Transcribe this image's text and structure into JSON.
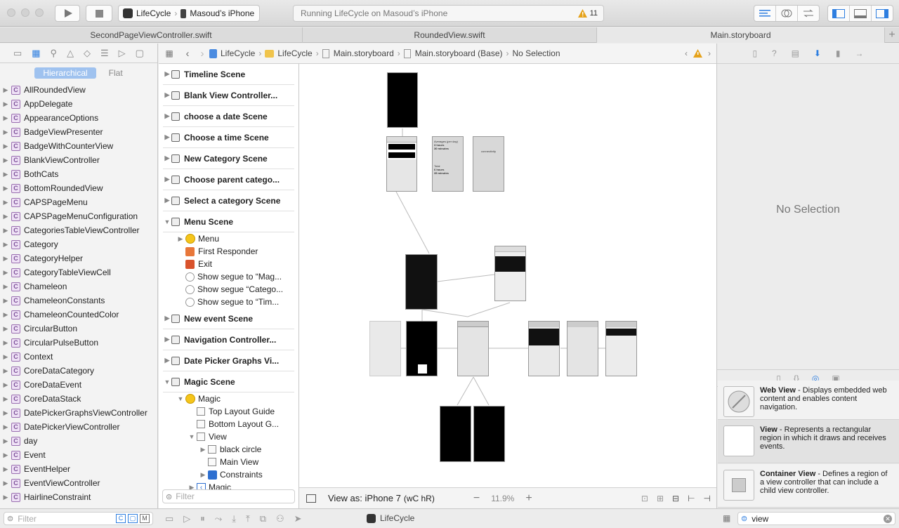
{
  "toolbar": {
    "scheme_app": "LifeCycle",
    "scheme_device": "Masoud’s iPhone",
    "status_text": "Running LifeCycle on Masoud’s iPhone",
    "warning_count": "11"
  },
  "tabs": [
    "SecondPageViewController.swift",
    "RoundedView.swift",
    "Main.storyboard"
  ],
  "navigator": {
    "mode_hierarchical": "Hierarchical",
    "mode_flat": "Flat",
    "items": [
      "AllRoundedView",
      "AppDelegate",
      "AppearanceOptions",
      "BadgeViewPresenter",
      "BadgeWithCounterView",
      "BlankViewController",
      "BothCats",
      "BottomRoundedView",
      "CAPSPageMenu",
      "CAPSPageMenuConfiguration",
      "CategoriesTableViewController",
      "Category",
      "CategoryHelper",
      "CategoryTableViewCell",
      "Chameleon",
      "ChameleonConstants",
      "ChameleonCountedColor",
      "CircularButton",
      "CircularPulseButton",
      "Context",
      "CoreDataCategory",
      "CoreDataEvent",
      "CoreDataStack",
      "DatePickerGraphsViewController",
      "DatePickerViewController",
      "day",
      "Event",
      "EventHelper",
      "EventViewController",
      "HairlineConstraint"
    ],
    "filter_placeholder": "Filter"
  },
  "jumpbar": {
    "crumbs": [
      "LifeCycle",
      "LifeCycle",
      "Main.storyboard",
      "Main.storyboard (Base)",
      "No Selection"
    ]
  },
  "outline": {
    "rows": [
      {
        "t": "scene",
        "label": "Timeline Scene",
        "open": false
      },
      {
        "t": "scene",
        "label": "Blank View Controller...",
        "open": false
      },
      {
        "t": "scene",
        "label": "choose a date Scene",
        "open": false
      },
      {
        "t": "scene",
        "label": "Choose a time Scene",
        "open": false
      },
      {
        "t": "scene",
        "label": "New Category Scene",
        "open": false
      },
      {
        "t": "scene",
        "label": "Choose parent catego...",
        "open": false
      },
      {
        "t": "scene",
        "label": "Select a category Scene",
        "open": false
      },
      {
        "t": "scene",
        "label": "Menu Scene",
        "open": true
      },
      {
        "t": "item",
        "label": "Menu",
        "indent": 1,
        "icon": "yellow"
      },
      {
        "t": "item",
        "label": "First Responder",
        "indent": 1,
        "icon": "orange"
      },
      {
        "t": "item",
        "label": "Exit",
        "indent": 1,
        "icon": "red"
      },
      {
        "t": "item",
        "label": "Show segue to “Mag...",
        "indent": 1,
        "icon": "segue"
      },
      {
        "t": "item",
        "label": "Show segue “Catego...",
        "indent": 1,
        "icon": "segue"
      },
      {
        "t": "item",
        "label": "Show segue to “Tim...",
        "indent": 1,
        "icon": "segue"
      },
      {
        "t": "scene",
        "label": "New event Scene",
        "open": false
      },
      {
        "t": "scene",
        "label": "Navigation Controller...",
        "open": false
      },
      {
        "t": "scene",
        "label": "Date Picker Graphs Vi...",
        "open": false
      },
      {
        "t": "scene",
        "label": "Magic Scene",
        "open": true
      },
      {
        "t": "item",
        "label": "Magic",
        "indent": 1,
        "icon": "yellow"
      },
      {
        "t": "item",
        "label": "Top Layout Guide",
        "indent": 2,
        "icon": "box"
      },
      {
        "t": "item",
        "label": "Bottom Layout G...",
        "indent": 2,
        "icon": "box"
      },
      {
        "t": "item",
        "label": "View",
        "indent": 2,
        "icon": "box"
      },
      {
        "t": "item",
        "label": "black circle",
        "indent": 3,
        "icon": "box"
      },
      {
        "t": "item",
        "label": "Main View",
        "indent": 3,
        "icon": "box"
      },
      {
        "t": "item",
        "label": "Constraints",
        "indent": 3,
        "icon": "blue"
      },
      {
        "t": "item",
        "label": "Magic",
        "indent": 2,
        "icon": "back"
      }
    ],
    "filter_placeholder": "Filter"
  },
  "canvas": {
    "view_as": "View as: iPhone 7",
    "size_class": "(wC hR)",
    "zoom": "11.9%",
    "screen_texts": {
      "avg": "Averages (per day)",
      "hours1": "3 hours",
      "mins1": "30 minutes",
      "total": "Total",
      "hours2": "6 hours",
      "mins2": "35 minutes",
      "connectivity": "connectivity"
    }
  },
  "inspector": {
    "no_selection": "No Selection",
    "library": [
      {
        "title": "Web View",
        "desc": " - Displays embedded web content and enables content navigation."
      },
      {
        "title": "View",
        "desc": " - Represents a rectangular region in which it draws and receives events."
      },
      {
        "title": "Container View",
        "desc": " - Defines a region of a view controller that can include a child view controller."
      }
    ],
    "search_value": "view"
  },
  "bottom": {
    "scheme_label": "LifeCycle"
  }
}
